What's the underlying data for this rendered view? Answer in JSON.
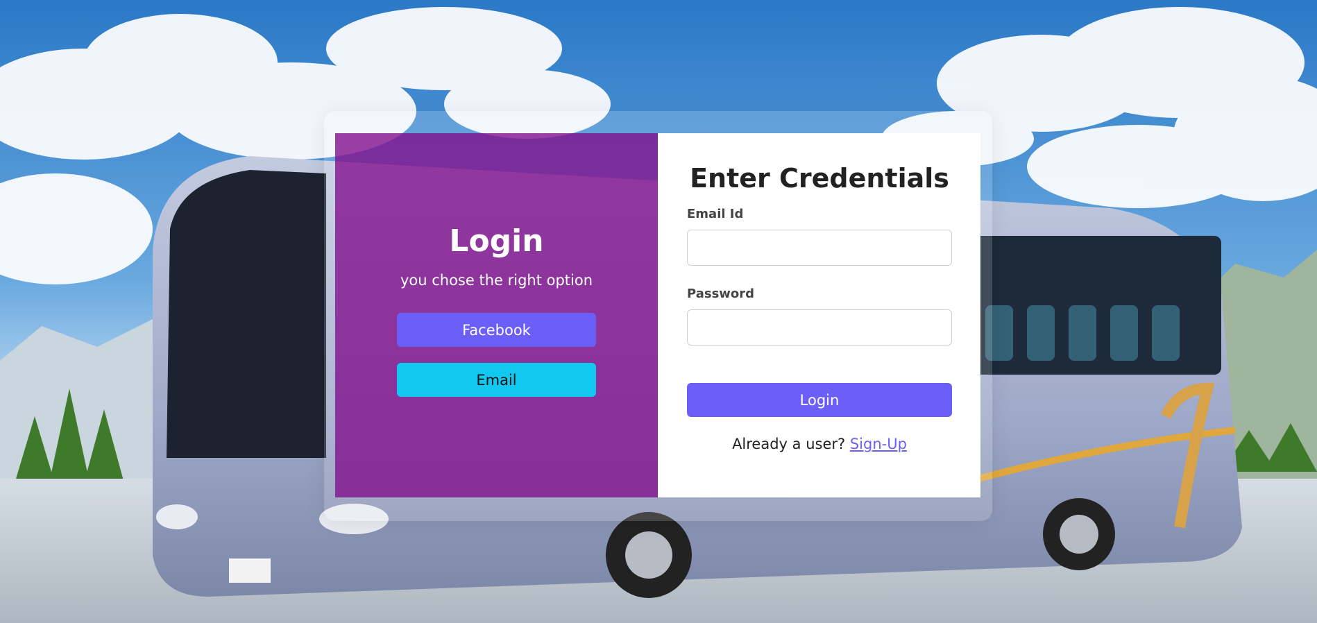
{
  "left_panel": {
    "title": "Login",
    "subtitle": "you chose the right option",
    "facebook_label": "Facebook",
    "email_label": "Email",
    "bg_color": "#800c8c"
  },
  "form": {
    "title": "Enter Credentials",
    "email_label": "Email Id",
    "email_value": "",
    "email_placeholder": "",
    "password_label": "Password",
    "password_value": "",
    "password_placeholder": "",
    "login_label": "Login",
    "signup_prompt": "Already a user?",
    "signup_link": "Sign-Up"
  },
  "colors": {
    "accent": "#6c5ff7",
    "email_button": "#11c9f0",
    "panel_purple": "#800c8c"
  },
  "icons": [
    "bus-background-image"
  ]
}
